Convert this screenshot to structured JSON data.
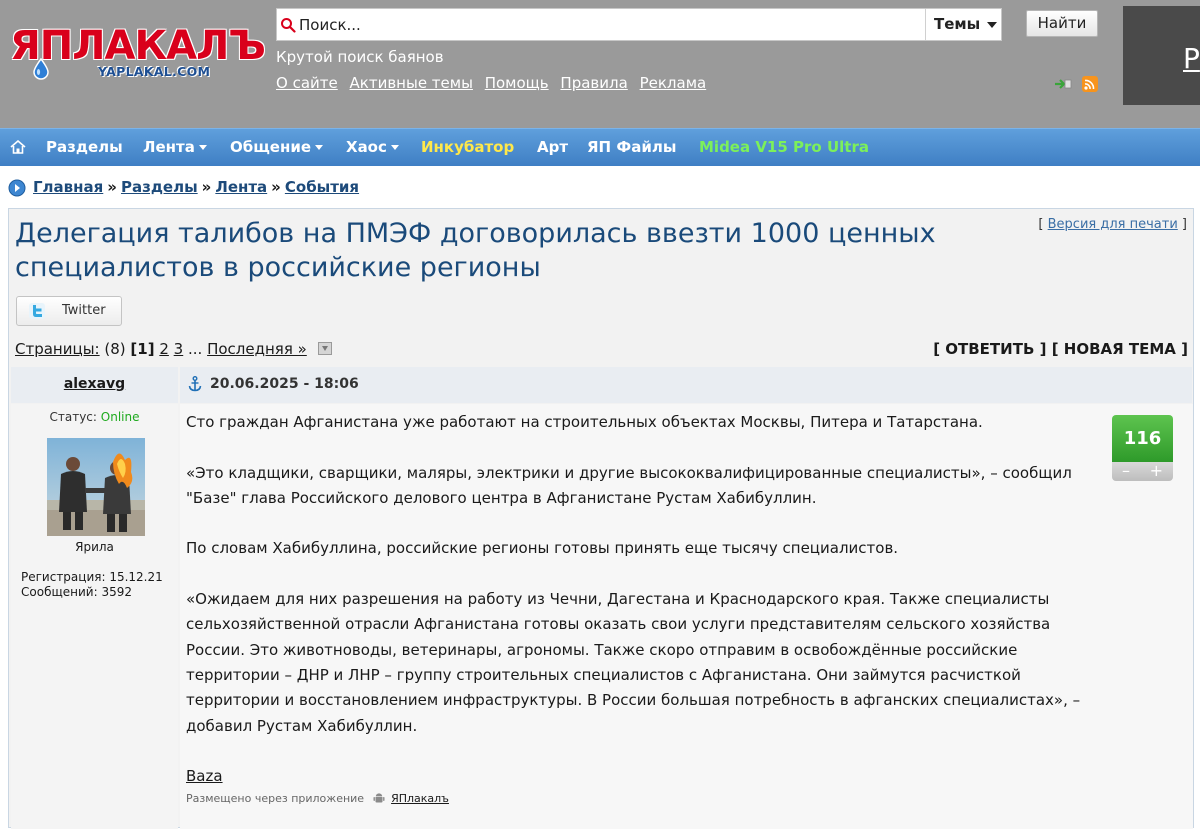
{
  "header": {
    "logo_text": "ЯПЛАКАЛЪ",
    "logo_sub": "YAPLAKAL.COM",
    "search_placeholder": "Поиск...",
    "topics_label": "Темы",
    "search_button": "Найти",
    "tagline": "Крутой поиск баянов",
    "links": [
      "О сайте",
      "Активные темы",
      "Помощь",
      "Правила",
      "Реклама"
    ],
    "banner_letter": "Р"
  },
  "nav": {
    "items": [
      {
        "label": "Разделы",
        "dropdown": false,
        "color": "#ffffff"
      },
      {
        "label": "Лента",
        "dropdown": true,
        "color": "#ffffff"
      },
      {
        "label": "Общение",
        "dropdown": true,
        "color": "#ffffff"
      },
      {
        "label": "Хаос",
        "dropdown": true,
        "color": "#ffffff"
      },
      {
        "label": "Инкубатор",
        "dropdown": false,
        "color": "#ffe84a"
      },
      {
        "label": "Арт",
        "dropdown": false,
        "color": "#ffffff"
      },
      {
        "label": "ЯП Файлы",
        "dropdown": false,
        "color": "#ffffff"
      },
      {
        "label": "Midea V15 Pro Ultra",
        "dropdown": false,
        "color": "#7cf05a"
      }
    ]
  },
  "breadcrumb": [
    "Главная",
    "Разделы",
    "Лента",
    "События"
  ],
  "topic": {
    "title": "Делегация талибов на ПМЭФ договорилась ввезти 1000 ценных специалистов в российские регионы",
    "print_link": "Версия для печати",
    "twitter_label": "Twitter",
    "pager": {
      "label": "Страницы:",
      "total": "(8)",
      "current": "[1]",
      "pages": [
        "2",
        "3"
      ],
      "ellipsis": "...",
      "last": "Последняя »"
    },
    "reply_label": "ОТВЕТИТЬ",
    "new_topic_label": "НОВАЯ ТЕМА"
  },
  "post": {
    "author": "alexavg",
    "date": "20.06.2025 - 18:06",
    "status_label": "Статус:",
    "status_value": "Online",
    "avatar_caption": "Ярила",
    "registration": "Регистрация: 15.12.21",
    "messages": "Сообщений: 3592",
    "rating": "116",
    "rating_minus": "–",
    "rating_plus": "+",
    "paragraphs": [
      "Сто граждан Афганистана уже работают на строительных объектах Москвы, Питера и Татарстана.",
      "«Это кладщики, сварщики, маляры, электрики и другие высококвалифицированные специалисты», – сообщил \"Базе\" глава Российского делового центра в Афганистане Рустам Хабибуллин.",
      "По словам Хабибуллина, российские регионы готовы принять еще тысячу специалистов.",
      "«Ожидаем для них разрешения на работу из Чечни, Дагестана и Краснодарского края. Также специалисты сельхозяйственной отрасли Афганистана готовы оказать свои услуги представителям сельского хозяйства России. Это животноводы, ветеринары, агрономы. Также скоро отправим в освобождённые российские территории – ДНР и ЛНР – группу строительных специалистов с Афганистана. Они займутся расчисткой территории и восстановлением инфраструктуры. В России большая потребность в афганских специалистах», – добавил Рустам Хабибуллин."
    ],
    "source_link": "Baza",
    "posted_via": "Размещено через приложение",
    "app_name": "ЯПлакалъ"
  }
}
